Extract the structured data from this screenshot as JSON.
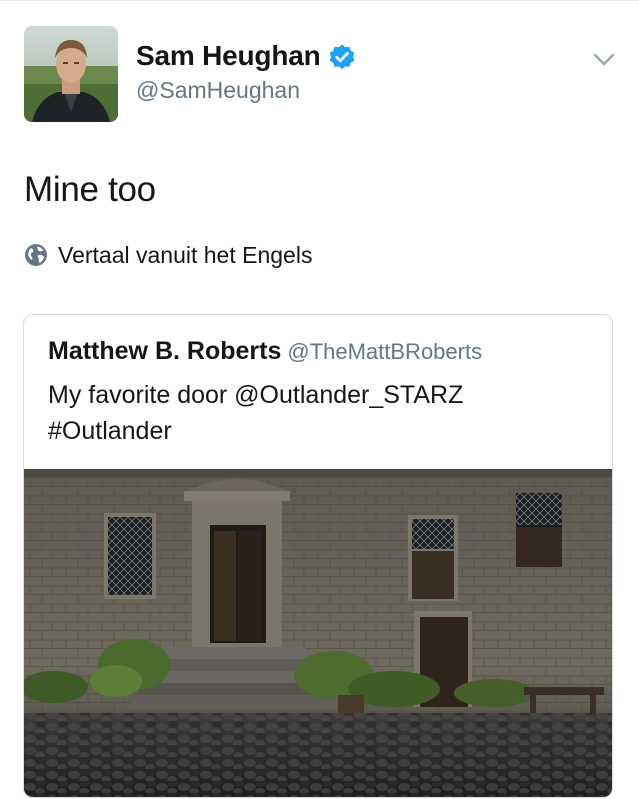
{
  "tweet": {
    "author_name": "Sam Heughan",
    "author_handle": "@SamHeughan",
    "text": "Mine too",
    "translate_label": "Vertaal vanuit het Engels"
  },
  "quoted_tweet": {
    "author_name": "Matthew B. Roberts",
    "author_handle": "@TheMattBRoberts",
    "text_line1": "My favorite door @Outlander_STARZ",
    "text_line2": "#Outlander"
  },
  "icons": {
    "verified": "verified-badge-icon",
    "menu": "chevron-down-icon",
    "translate": "globe-icon"
  },
  "colors": {
    "verified_blue": "#1da1f2",
    "secondary_text": "#657786",
    "primary_text": "#14171a",
    "border": "#d8dde1"
  }
}
